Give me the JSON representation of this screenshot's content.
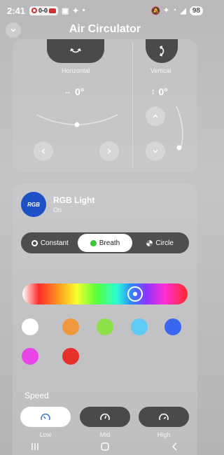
{
  "status_bar": {
    "time": "2:41",
    "chip_text": "0-0",
    "battery": "98"
  },
  "header": {
    "title": "Air Circulator"
  },
  "swing": {
    "horizontal": {
      "label": "Horizontal",
      "angle": "0°"
    },
    "vertical": {
      "label": "Vertical",
      "angle": "0°"
    }
  },
  "rgb": {
    "title": "RGB Light",
    "logo_text": "RGB",
    "status": "On",
    "modes": [
      {
        "label": "Constant",
        "active": false
      },
      {
        "label": "Breath",
        "active": true
      },
      {
        "label": "Circle",
        "active": false
      }
    ],
    "swatches": [
      "#ffffff",
      "#f0963c",
      "#8ee04a",
      "#5ecbf5",
      "#3a66f0",
      "#e844e8",
      "#e8302a"
    ],
    "accent_color": "#1e50c8"
  },
  "speed": {
    "label": "Speed",
    "options": [
      {
        "label": "Low",
        "active": true
      },
      {
        "label": "Mid",
        "active": false
      },
      {
        "label": "High",
        "active": false
      }
    ]
  }
}
